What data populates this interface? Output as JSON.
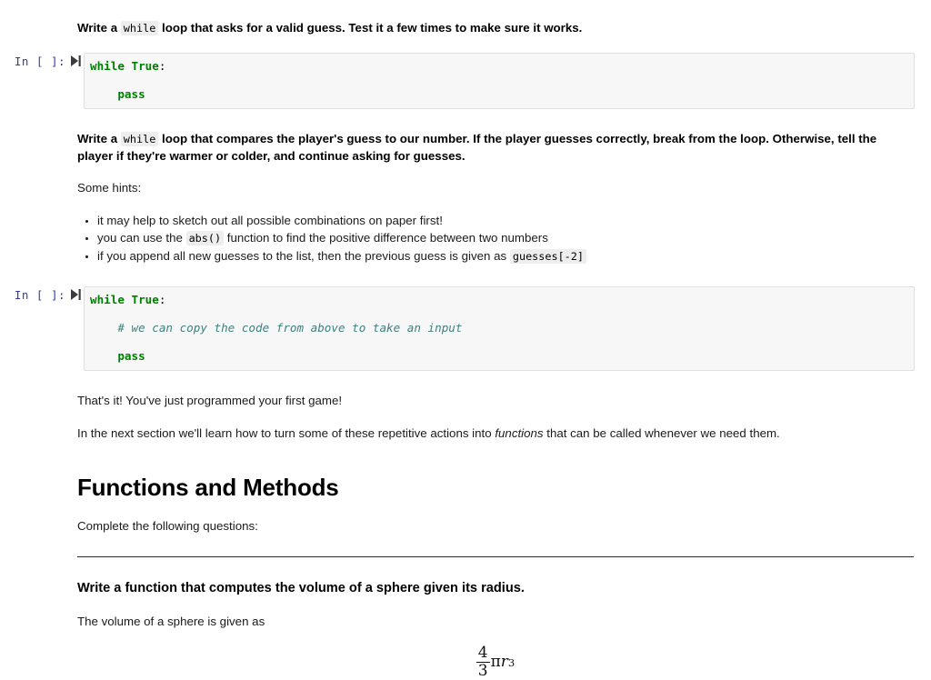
{
  "notebook": {
    "prompt_label": "In [ ]:",
    "run_icon_name": "run-cell-icon",
    "cells": [
      {
        "type": "markdown",
        "id": "md-while-valid-guess",
        "paragraphs": [
          {
            "style": "bold",
            "segments": [
              {
                "kind": "text",
                "value": "Write a "
              },
              {
                "kind": "code",
                "value": "while"
              },
              {
                "kind": "text",
                "value": " loop that asks for a valid guess. Test it a few times to make sure it works."
              }
            ]
          }
        ]
      },
      {
        "type": "code",
        "id": "code-while-valid-guess",
        "lines": [
          [
            {
              "kind": "kw",
              "value": "while"
            },
            {
              "kind": "text",
              "value": " "
            },
            {
              "kind": "builtin",
              "value": "True"
            },
            {
              "kind": "text",
              "value": ":"
            }
          ],
          [],
          [
            {
              "kind": "text",
              "value": "    "
            },
            {
              "kind": "kw",
              "value": "pass"
            }
          ]
        ]
      },
      {
        "type": "markdown",
        "id": "md-compare-guess",
        "paragraphs": [
          {
            "style": "bold",
            "segments": [
              {
                "kind": "text",
                "value": "Write a "
              },
              {
                "kind": "code",
                "value": "while"
              },
              {
                "kind": "text",
                "value": " loop that compares the player's guess to our number. If the player guesses correctly, break from the loop. Otherwise, tell the player if they're warmer or colder, and continue asking for guesses."
              }
            ]
          },
          {
            "style": "body",
            "segments": [
              {
                "kind": "text",
                "value": "Some hints:"
              }
            ]
          }
        ],
        "bullets": [
          [
            {
              "kind": "text",
              "value": "it may help to sketch out all possible combinations on paper first!"
            }
          ],
          [
            {
              "kind": "text",
              "value": "you can use the "
            },
            {
              "kind": "code",
              "value": "abs()"
            },
            {
              "kind": "text",
              "value": " function to find the positive difference between two numbers"
            }
          ],
          [
            {
              "kind": "text",
              "value": "if you append all new guesses to the list, then the previous guess is given as "
            },
            {
              "kind": "code",
              "value": "guesses[-2]"
            }
          ]
        ]
      },
      {
        "type": "code",
        "id": "code-compare-guess",
        "lines": [
          [
            {
              "kind": "kw",
              "value": "while"
            },
            {
              "kind": "text",
              "value": " "
            },
            {
              "kind": "builtin",
              "value": "True"
            },
            {
              "kind": "text",
              "value": ":"
            }
          ],
          [],
          [
            {
              "kind": "text",
              "value": "    "
            },
            {
              "kind": "comment",
              "value": "# we can copy the code from above to take an input"
            }
          ],
          [],
          [
            {
              "kind": "text",
              "value": "    "
            },
            {
              "kind": "kw",
              "value": "pass"
            }
          ]
        ]
      },
      {
        "type": "markdown",
        "id": "md-thats-it",
        "paragraphs": [
          {
            "style": "body",
            "segments": [
              {
                "kind": "text",
                "value": "That's it! You've just programmed your first game!"
              }
            ]
          }
        ]
      },
      {
        "type": "markdown",
        "id": "md-next-section",
        "paragraphs": [
          {
            "style": "body",
            "segments": [
              {
                "kind": "text",
                "value": "In the next section we'll learn how to turn some of these repetitive actions into "
              },
              {
                "kind": "em",
                "value": "functions"
              },
              {
                "kind": "text",
                "value": " that can be called whenever we need them."
              }
            ]
          }
        ]
      },
      {
        "type": "markdown",
        "id": "md-functions-heading",
        "heading": "Functions and Methods",
        "paragraphs": [
          {
            "style": "body",
            "segments": [
              {
                "kind": "text",
                "value": "Complete the following questions:"
              }
            ]
          }
        ],
        "rule": true
      },
      {
        "type": "markdown",
        "id": "md-sphere-volume",
        "paragraphs": [
          {
            "style": "bold",
            "segments": [
              {
                "kind": "text",
                "value": "Write a function that computes the volume of a sphere given its radius."
              }
            ]
          },
          {
            "style": "body",
            "segments": [
              {
                "kind": "text",
                "value": "The volume of a sphere is given as"
              }
            ]
          }
        ],
        "math": {
          "latex": "\\frac{4}{3}\\pi r^3",
          "numerator": "4",
          "denominator": "3",
          "pi": "π",
          "variable": "r",
          "exponent": "3"
        }
      }
    ]
  },
  "colors": {
    "keyword": "#008000",
    "comment": "#408080",
    "prompt": "#303f9f",
    "cell_background": "#f7f7f7",
    "cell_border": "#dfdfdf",
    "inline_code_background": "#eeeeee",
    "page_background": "#ffffff"
  }
}
